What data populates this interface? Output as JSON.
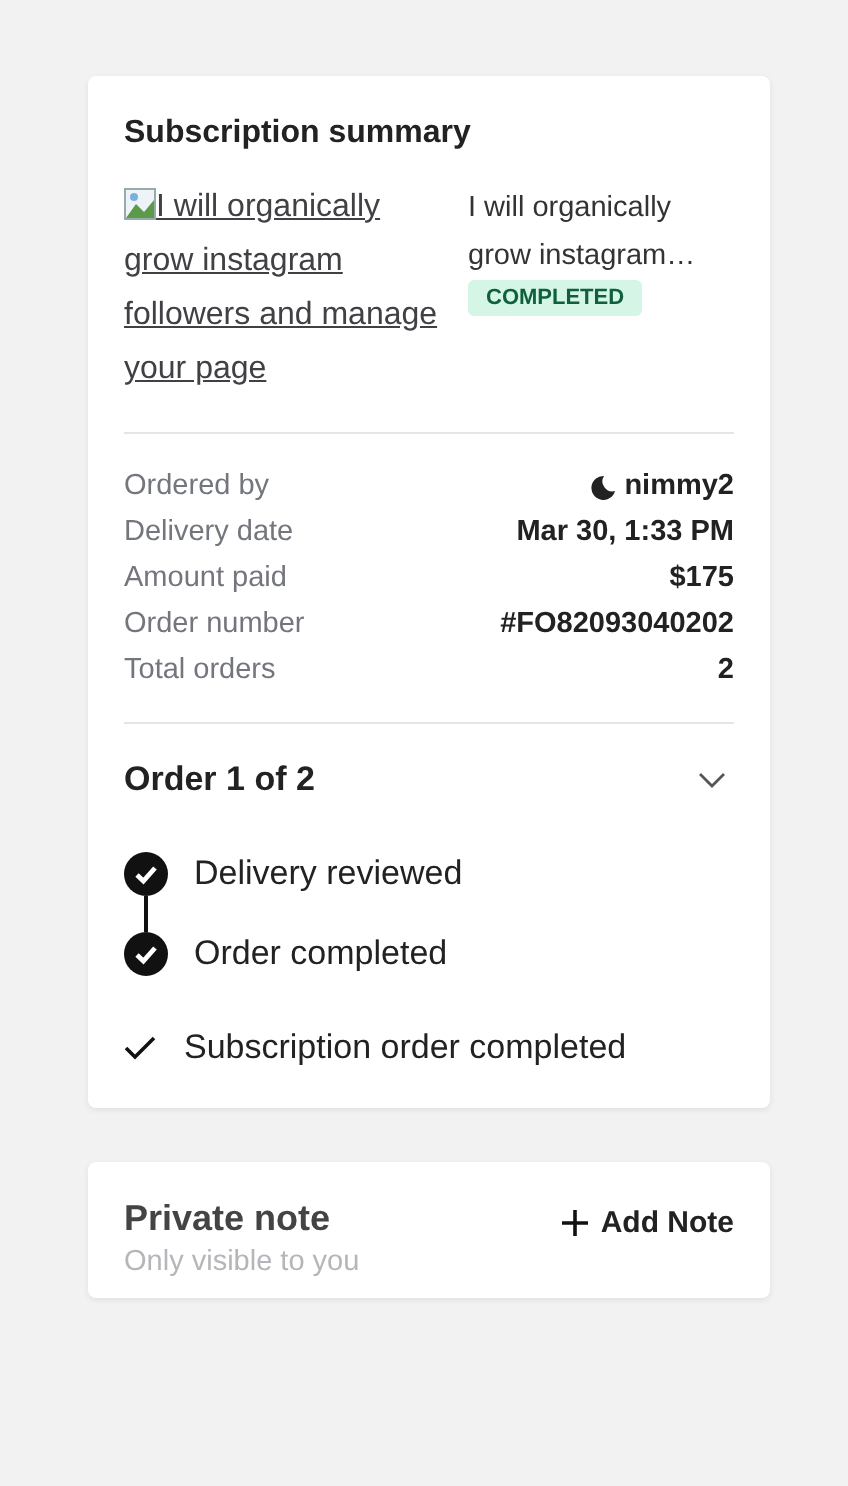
{
  "summary": {
    "title": "Subscription summary",
    "image_alt": "I will organically grow instagram followers and manage your page",
    "gig_title": "I will organically grow instagram…",
    "status": "COMPLETED",
    "details": [
      {
        "label": "Ordered by",
        "value": "nimmy2",
        "kind": "user"
      },
      {
        "label": "Delivery date",
        "value": "Mar 30, 1:33 PM",
        "kind": "text"
      },
      {
        "label": "Amount paid",
        "value": "$175",
        "kind": "text"
      },
      {
        "label": "Order number",
        "value": "#FO82093040202",
        "kind": "text"
      },
      {
        "label": "Total orders",
        "value": "2",
        "kind": "text"
      }
    ],
    "order": {
      "title": "Order 1 of 2",
      "steps": [
        {
          "label": "Delivery reviewed",
          "completed": true
        },
        {
          "label": "Order completed",
          "completed": true
        }
      ],
      "final": "Subscription order completed"
    }
  },
  "note": {
    "title": "Private note",
    "subtitle": "Only visible to you",
    "action": "Add Note"
  }
}
